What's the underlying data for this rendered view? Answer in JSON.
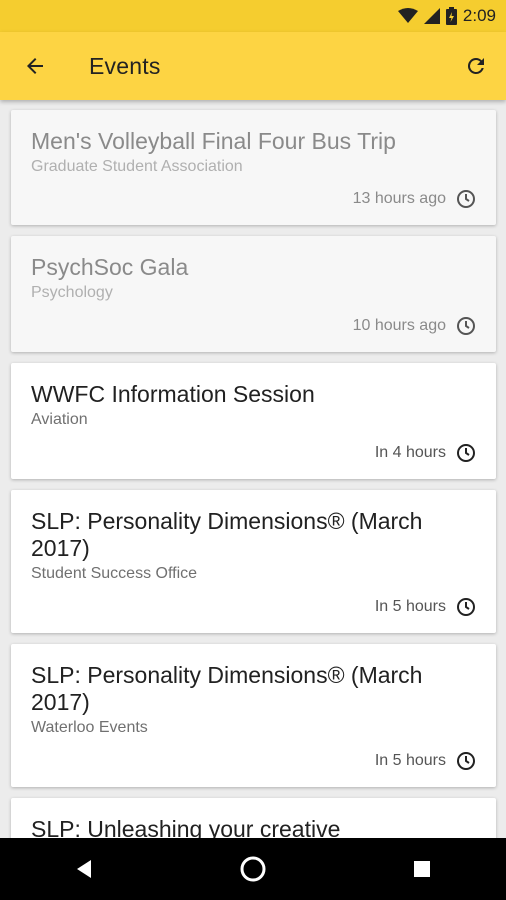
{
  "status_bar": {
    "time": "2:09",
    "icons": [
      "wifi-icon",
      "signal-icon",
      "battery-icon"
    ]
  },
  "app_bar": {
    "title": "Events",
    "back_icon": "arrow-left-icon",
    "refresh_icon": "refresh-icon"
  },
  "events": [
    {
      "title": "Men's Volleyball Final Four Bus Trip",
      "org": "Graduate Student Association",
      "time": "13 hours ago",
      "past": true
    },
    {
      "title": "PsychSoc Gala",
      "org": "Psychology",
      "time": "10 hours ago",
      "past": true
    },
    {
      "title": "WWFC Information Session",
      "org": "Aviation",
      "time": "In 4 hours",
      "past": false
    },
    {
      "title": "SLP: Personality Dimensions® (March 2017)",
      "org": "Student Success Office",
      "time": "In 5 hours",
      "past": false
    },
    {
      "title": "SLP: Personality Dimensions® (March 2017)",
      "org": "Waterloo Events",
      "time": "In 5 hours",
      "past": false
    },
    {
      "title": "SLP: Unleashing your creative",
      "org": "",
      "time": "",
      "past": false
    }
  ],
  "colors": {
    "accent": "#fdd443",
    "status_bar": "#f5cd2f"
  },
  "nav_bar": {
    "icons": [
      "back-triangle-icon",
      "home-circle-icon",
      "recents-square-icon"
    ]
  }
}
